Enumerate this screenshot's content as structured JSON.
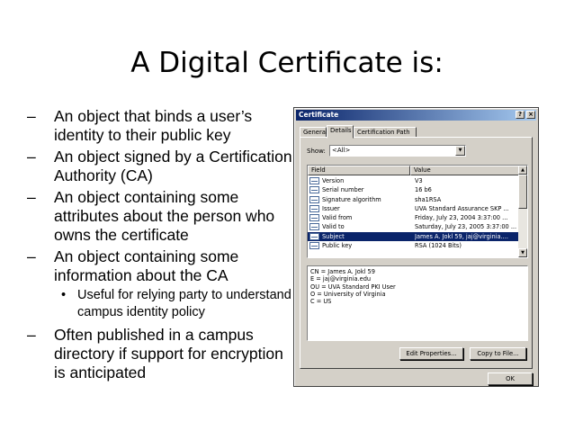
{
  "slide": {
    "title": "A Digital Certificate is:",
    "bullets": [
      "An object that binds a user’s identity to their public key",
      "An object signed by a Certification Authority (CA)",
      "An object containing some attributes about the person who owns the certificate",
      "An object containing some information about the CA",
      "Often published in a campus directory if support for encryption is anticipated"
    ],
    "dash": "–",
    "sub_bullets": [
      "Useful for relying party to understand campus identity policy"
    ],
    "dot": "•"
  },
  "dialog": {
    "title": "Certificate",
    "help_btn": "?",
    "close_btn": "×",
    "tabs": [
      "General",
      "Details",
      "Certification Path"
    ],
    "active_tab": "Details",
    "show_label": "Show:",
    "show_value": "<All>",
    "dropdown_icon": "triangle-down",
    "columns": [
      "Field",
      "Value"
    ],
    "rows": [
      {
        "field": "Version",
        "value": "V3"
      },
      {
        "field": "Serial number",
        "value": "16 b6"
      },
      {
        "field": "Signature algorithm",
        "value": "sha1RSA"
      },
      {
        "field": "Issuer",
        "value": "UVA Standard Assurance SKP ..."
      },
      {
        "field": "Valid from",
        "value": "Friday, July 23, 2004 3:37:00 ..."
      },
      {
        "field": "Valid to",
        "value": "Saturday, July 23, 2005 3:37:00 ..."
      },
      {
        "field": "Subject",
        "value": "James A. Jokl 59, jaj@virginia...."
      },
      {
        "field": "Public key",
        "value": "RSA (1024 Bits)"
      }
    ],
    "selected_row": "Subject",
    "detail_lines": [
      "CN = James A. Jokl 59",
      "E = jaj@virginia.edu",
      "OU = UVA Standard PKI User",
      "O = University of Virginia",
      "C = US"
    ],
    "edit_properties_btn": "Edit Properties...",
    "copy_to_file_btn": "Copy to File...",
    "ok_btn": "OK",
    "colors": {
      "title_bar": "#0a246a",
      "selection": "#0a246a",
      "face": "#d4d0c8"
    }
  }
}
